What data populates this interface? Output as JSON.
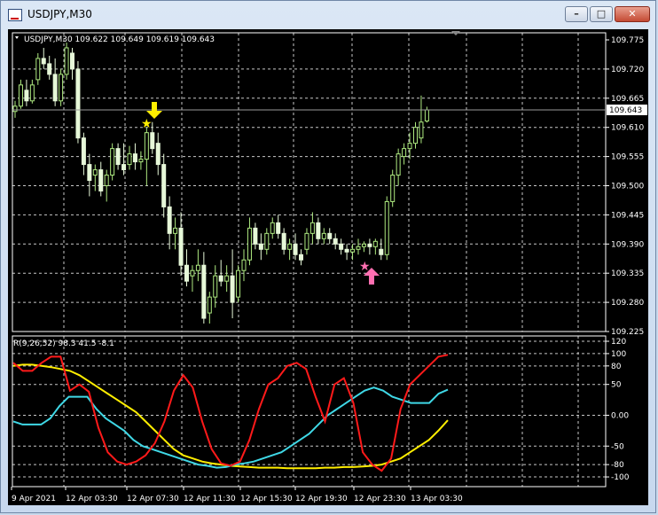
{
  "window": {
    "title": "USDJPY,M30",
    "min": "–",
    "max": "□",
    "close": "✕"
  },
  "chart": {
    "header": "USDJPY,M30  109.622 109.649 109.619 109.643",
    "price_labels": [
      "109.775",
      "109.720",
      "109.665",
      "109.610",
      "109.555",
      "109.500",
      "109.445",
      "109.390",
      "109.335",
      "109.280",
      "109.225"
    ],
    "current_price": "109.643",
    "time_labels": [
      "9 Apr 2021",
      "12 Apr 03:30",
      "12 Apr 07:30",
      "12 Apr 11:30",
      "12 Apr 15:30",
      "12 Apr 19:30",
      "12 Apr 23:30",
      "13 Apr 03:30"
    ]
  },
  "indicator": {
    "header": "R(9,26,52) 98.3 41.5 -8.1",
    "labels": [
      "120",
      "100",
      "80",
      "50",
      "0.00",
      "-50",
      "-80",
      "-100"
    ]
  },
  "colors": {
    "bull": "#aeea80",
    "bear": "#e6f8d8",
    "red": "#ff1a1a",
    "cyan": "#3fd8e6",
    "yellow": "#ffee00",
    "pink": "#ff6fb1",
    "arrow_down": "#ffee00"
  },
  "chart_data": {
    "type": "candlestick",
    "y_range": [
      109.225,
      109.775
    ],
    "candles": [
      [
        109.64,
        109.66,
        109.628,
        109.65
      ],
      [
        109.65,
        109.7,
        109.645,
        109.69
      ],
      [
        109.68,
        109.7,
        109.65,
        109.66
      ],
      [
        109.66,
        109.7,
        109.655,
        109.69
      ],
      [
        109.7,
        109.75,
        109.69,
        109.74
      ],
      [
        109.74,
        109.76,
        109.72,
        109.73
      ],
      [
        109.73,
        109.745,
        109.7,
        109.71
      ],
      [
        109.71,
        109.74,
        109.65,
        109.66
      ],
      [
        109.66,
        109.72,
        109.65,
        109.71
      ],
      [
        109.71,
        109.77,
        109.7,
        109.76
      ],
      [
        109.75,
        109.76,
        109.7,
        109.72
      ],
      [
        109.72,
        109.735,
        109.58,
        109.59
      ],
      [
        109.59,
        109.6,
        109.52,
        109.54
      ],
      [
        109.54,
        109.56,
        109.48,
        109.51
      ],
      [
        109.52,
        109.54,
        109.49,
        109.53
      ],
      [
        109.53,
        109.545,
        109.48,
        109.49
      ],
      [
        109.5,
        109.53,
        109.47,
        109.52
      ],
      [
        109.52,
        109.58,
        109.51,
        109.57
      ],
      [
        109.57,
        109.58,
        109.53,
        109.54
      ],
      [
        109.54,
        109.58,
        109.52,
        109.53
      ],
      [
        109.54,
        109.575,
        109.53,
        109.56
      ],
      [
        109.56,
        109.58,
        109.53,
        109.545
      ],
      [
        109.545,
        109.565,
        109.53,
        109.55
      ],
      [
        109.55,
        109.61,
        109.5,
        109.6
      ],
      [
        109.6,
        109.62,
        109.56,
        109.57
      ],
      [
        109.58,
        109.6,
        109.52,
        109.54
      ],
      [
        109.54,
        109.56,
        109.44,
        109.46
      ],
      [
        109.46,
        109.48,
        109.38,
        109.41
      ],
      [
        109.41,
        109.44,
        109.38,
        109.42
      ],
      [
        109.42,
        109.45,
        109.33,
        109.35
      ],
      [
        109.35,
        109.38,
        109.31,
        109.32
      ],
      [
        109.33,
        109.35,
        109.3,
        109.34
      ],
      [
        109.34,
        109.38,
        109.32,
        109.35
      ],
      [
        109.35,
        109.375,
        109.24,
        109.25
      ],
      [
        109.26,
        109.3,
        109.24,
        109.29
      ],
      [
        109.29,
        109.35,
        109.27,
        109.33
      ],
      [
        109.33,
        109.36,
        109.31,
        109.32
      ],
      [
        109.32,
        109.35,
        109.3,
        109.33
      ],
      [
        109.33,
        109.38,
        109.25,
        109.28
      ],
      [
        109.29,
        109.35,
        109.28,
        109.34
      ],
      [
        109.34,
        109.38,
        109.32,
        109.36
      ],
      [
        109.36,
        109.44,
        109.35,
        109.42
      ],
      [
        109.42,
        109.43,
        109.38,
        109.39
      ],
      [
        109.39,
        109.41,
        109.36,
        109.38
      ],
      [
        109.38,
        109.42,
        109.37,
        109.41
      ],
      [
        109.41,
        109.44,
        109.4,
        109.43
      ],
      [
        109.43,
        109.445,
        109.4,
        109.41
      ],
      [
        109.41,
        109.42,
        109.37,
        109.38
      ],
      [
        109.38,
        109.4,
        109.36,
        109.39
      ],
      [
        109.39,
        109.41,
        109.36,
        109.37
      ],
      [
        109.37,
        109.38,
        109.35,
        109.36
      ],
      [
        109.38,
        109.42,
        109.37,
        109.41
      ],
      [
        109.41,
        109.45,
        109.39,
        109.43
      ],
      [
        109.43,
        109.44,
        109.39,
        109.4
      ],
      [
        109.4,
        109.42,
        109.39,
        109.41
      ],
      [
        109.41,
        109.42,
        109.39,
        109.4
      ],
      [
        109.4,
        109.41,
        109.38,
        109.39
      ],
      [
        109.39,
        109.4,
        109.37,
        109.38
      ],
      [
        109.38,
        109.39,
        109.36,
        109.375
      ],
      [
        109.375,
        109.39,
        109.36,
        109.38
      ],
      [
        109.38,
        109.4,
        109.37,
        109.385
      ],
      [
        109.385,
        109.395,
        109.375,
        109.39
      ],
      [
        109.39,
        109.4,
        109.37,
        109.385
      ],
      [
        109.385,
        109.4,
        109.37,
        109.395
      ],
      [
        109.38,
        109.4,
        109.36,
        109.37
      ],
      [
        109.37,
        109.48,
        109.36,
        109.47
      ],
      [
        109.47,
        109.53,
        109.46,
        109.52
      ],
      [
        109.52,
        109.57,
        109.5,
        109.56
      ],
      [
        109.555,
        109.58,
        109.54,
        109.57
      ],
      [
        109.57,
        109.6,
        109.55,
        109.58
      ],
      [
        109.58,
        109.62,
        109.57,
        109.61
      ],
      [
        109.59,
        109.67,
        109.58,
        109.62
      ],
      [
        109.622,
        109.649,
        109.619,
        109.643
      ]
    ],
    "indicator_range": [
      -110,
      120
    ],
    "red_series": [
      85,
      72,
      72,
      85,
      95,
      95,
      40,
      50,
      38,
      -20,
      -60,
      -75,
      -80,
      -75,
      -65,
      -45,
      -10,
      40,
      65,
      45,
      -10,
      -55,
      -78,
      -82,
      -75,
      -40,
      10,
      50,
      60,
      80,
      85,
      75,
      30,
      -10,
      50,
      60,
      20,
      -60,
      -80,
      -90,
      -70,
      10,
      50,
      65,
      80,
      95,
      98
    ],
    "cyan_series": [
      -10,
      -15,
      -15,
      -15,
      -5,
      15,
      30,
      30,
      30,
      10,
      -5,
      -15,
      -25,
      -40,
      -50,
      -55,
      -60,
      -65,
      -70,
      -75,
      -80,
      -82,
      -85,
      -84,
      -80,
      -78,
      -75,
      -70,
      -65,
      -60,
      -50,
      -40,
      -30,
      -15,
      0,
      10,
      20,
      30,
      40,
      45,
      40,
      30,
      25,
      20,
      20,
      20,
      35,
      41.5
    ],
    "yellow_series": [
      80,
      82,
      82,
      80,
      78,
      75,
      72,
      65,
      55,
      45,
      35,
      25,
      15,
      5,
      -10,
      -25,
      -40,
      -55,
      -65,
      -70,
      -75,
      -78,
      -80,
      -82,
      -83,
      -84,
      -85,
      -85,
      -85,
      -86,
      -86,
      -86,
      -86,
      -85,
      -85,
      -84,
      -84,
      -83,
      -82,
      -80,
      -75,
      -70,
      -60,
      -50,
      -40,
      -25,
      -8.1
    ]
  }
}
